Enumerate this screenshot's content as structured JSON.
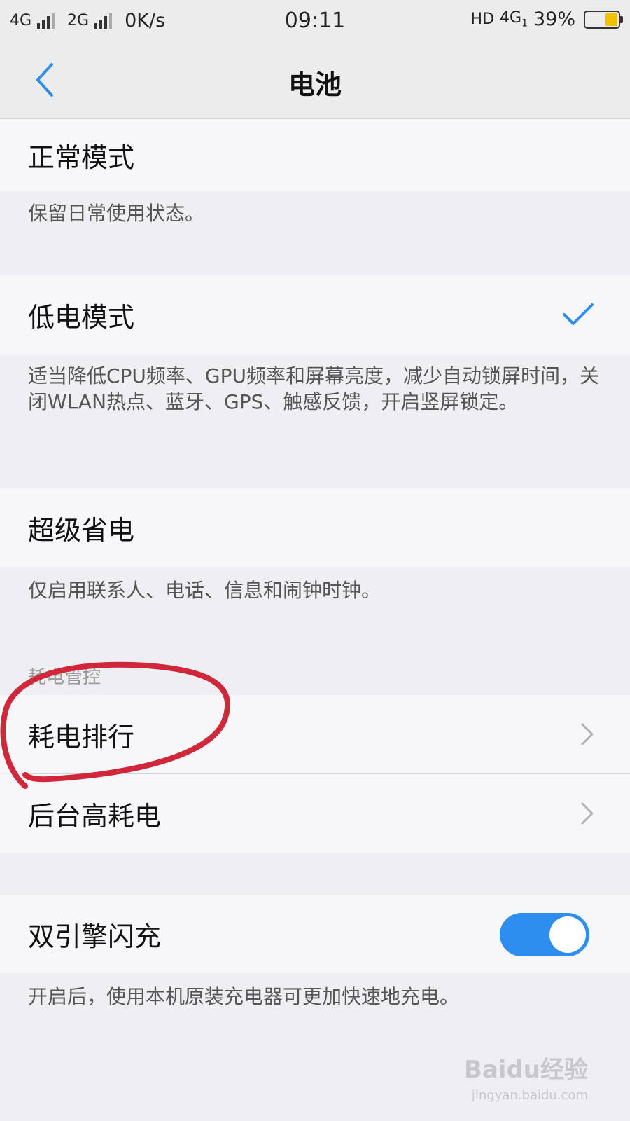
{
  "status_bar": {
    "net1": "4G",
    "net2": "2G",
    "speed": "0K/s",
    "time": "09:11",
    "hd_label": "HD",
    "volte_label": "4G",
    "volte_sub": "1",
    "battery_percent_text": "39%",
    "battery_level": 0.39,
    "battery_fill_color": "#f0c000"
  },
  "header": {
    "back_icon": "chevron-left-icon",
    "title": "电池",
    "accent_color": "#2d8ef0"
  },
  "modes": [
    {
      "label": "正常模式",
      "description": "保留日常使用状态。",
      "selected": false
    },
    {
      "label": "低电模式",
      "description": "适当降低CPU频率、GPU频率和屏幕亮度，减少自动锁屏时间，关闭WLAN热点、蓝牙、GPS、触感反馈，开启竖屏锁定。",
      "selected": true
    },
    {
      "label": "超级省电",
      "description": "仅启用联系人、电话、信息和闹钟时钟。",
      "selected": false
    }
  ],
  "power_management": {
    "section_title": "耗电管控",
    "items": [
      {
        "label": "耗电排行",
        "icon": "chevron-right-icon"
      },
      {
        "label": "后台高耗电",
        "icon": "chevron-right-icon"
      }
    ]
  },
  "dual_charge": {
    "label": "双引擎闪充",
    "enabled": true,
    "description": "开启后，使用本机原装充电器可更加快速地充电。"
  },
  "annotation": {
    "shape": "hand-drawn-circle",
    "color": "#d0283a"
  },
  "watermark": {
    "main": "Baidu经验",
    "sub": "jingyan.baidu.com"
  }
}
